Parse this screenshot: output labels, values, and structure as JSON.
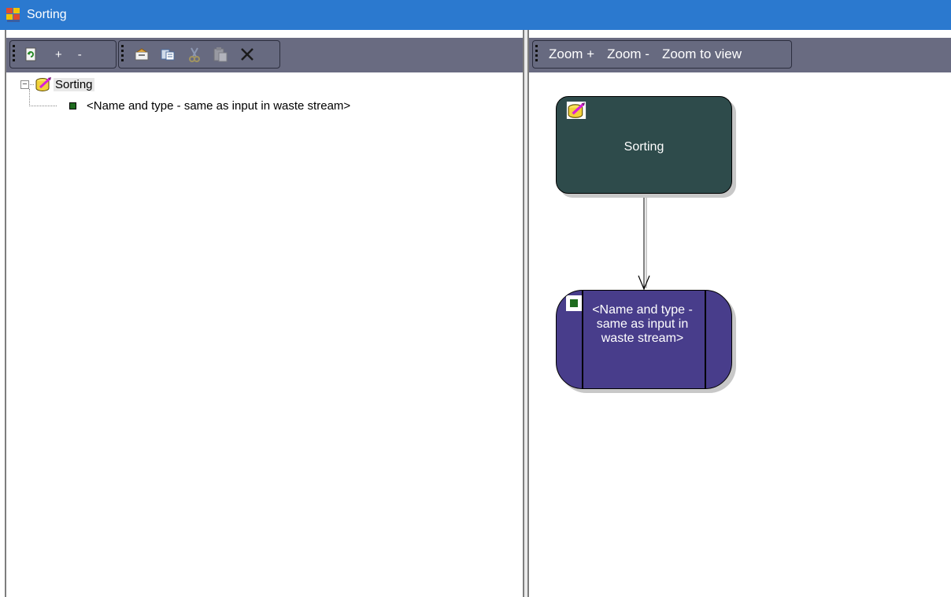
{
  "window": {
    "title": "Sorting"
  },
  "left_toolbar": {
    "buttons": [
      {
        "name": "refresh",
        "icon": "refresh-icon"
      },
      {
        "name": "expand",
        "label": "+"
      },
      {
        "name": "collapse",
        "label": "-"
      },
      {
        "name": "properties",
        "icon": "properties-icon"
      },
      {
        "name": "copy",
        "icon": "copy-icon"
      },
      {
        "name": "cut",
        "icon": "cut-icon"
      },
      {
        "name": "paste",
        "icon": "paste-icon"
      },
      {
        "name": "delete",
        "icon": "delete-icon"
      }
    ]
  },
  "right_toolbar": {
    "zoom_in": "Zoom +",
    "zoom_out": "Zoom -",
    "zoom_to_view": "Zoom to view"
  },
  "tree": {
    "root": {
      "label": "Sorting",
      "icon": "process-icon",
      "expander": "−"
    },
    "children": [
      {
        "label": "<Name and type - same as input in waste stream>",
        "icon": "flow-icon"
      }
    ]
  },
  "diagram": {
    "process_node": {
      "label": "Sorting",
      "icon": "process-icon"
    },
    "flow_node": {
      "label": "<Name and type - same as input in waste stream>",
      "icon": "flow-icon"
    }
  },
  "colors": {
    "titlebar": "#2b79cf",
    "toolbar": "#696b81",
    "process_node": "#2e4b4b",
    "flow_node": "#483d8b",
    "flow_icon": "#1f6b1f"
  }
}
